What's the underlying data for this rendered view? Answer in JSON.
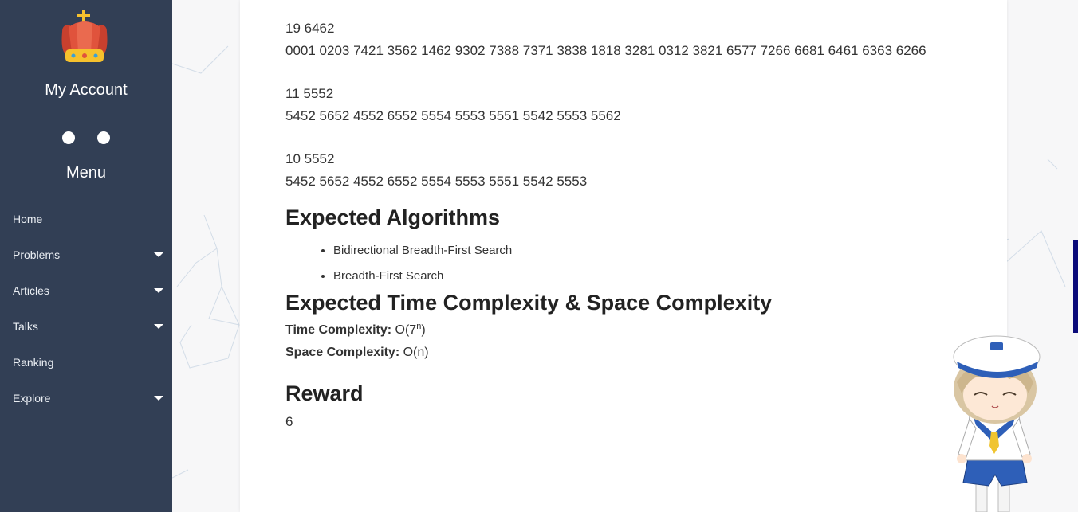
{
  "sidebar": {
    "account_title": "My Account",
    "menu_title": "Menu",
    "items": [
      {
        "label": "Home",
        "has_caret": false
      },
      {
        "label": "Problems",
        "has_caret": true
      },
      {
        "label": "Articles",
        "has_caret": true
      },
      {
        "label": "Talks",
        "has_caret": true
      },
      {
        "label": "Ranking",
        "has_caret": false
      },
      {
        "label": "Explore",
        "has_caret": true
      }
    ]
  },
  "content": {
    "samples": [
      {
        "header": "19 6462",
        "body": "0001 0203 7421 3562 1462 9302 7388 7371 3838 1818 3281 0312 3821 6577 7266 6681 6461 6363 6266"
      },
      {
        "header": "11 5552",
        "body": "5452 5652 4552 6552 5554 5553 5551 5542 5553 5562"
      },
      {
        "header": "10 5552",
        "body": "5452 5652 4552 6552 5554 5553 5551 5542 5553"
      }
    ],
    "algorithms_heading": "Expected Algorithms",
    "algorithms": [
      "Bidirectional Breadth-First Search",
      "Breadth-First Search"
    ],
    "complexity_heading": "Expected Time Complexity & Space Complexity",
    "time_label": "Time Complexity:",
    "time_value_base": "O(7",
    "time_value_sup": "n",
    "time_value_end": ")",
    "space_label": "Space Complexity:",
    "space_value": "O(n)",
    "reward_heading": "Reward",
    "reward_value": "6"
  },
  "colors": {
    "sidebar_bg": "#323f55",
    "accent_edge": "#0b0b7a"
  }
}
